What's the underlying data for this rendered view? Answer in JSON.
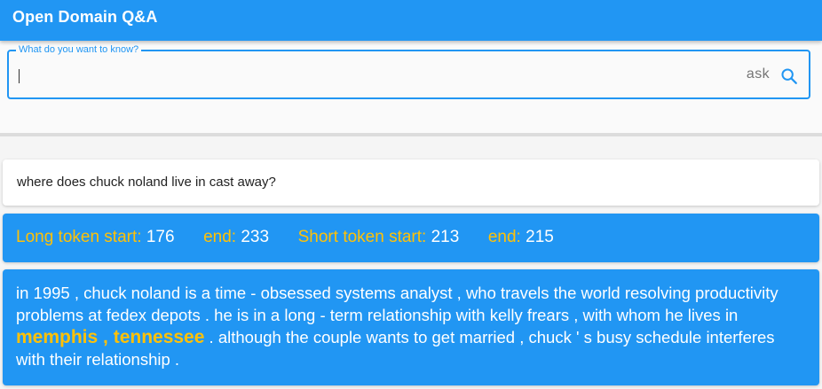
{
  "app": {
    "title": "Open Domain Q&A"
  },
  "search": {
    "label": "What do you want to know?",
    "value": "",
    "ask_label": "ask",
    "icon": "search-icon"
  },
  "question": {
    "text": "where does chuck noland live in cast away?"
  },
  "tokens": {
    "long_start_label": "Long token start:",
    "long_start_value": "176",
    "long_end_label": "end:",
    "long_end_value": "233",
    "short_start_label": "Short token start:",
    "short_start_value": "213",
    "short_end_label": "end:",
    "short_end_value": "215"
  },
  "answer": {
    "before": "in 1995 , chuck noland is a time - obsessed systems analyst , who travels the world resolving productivity problems at fedex depots . he is in a long - term relationship with kelly frears , with whom he lives in ",
    "highlight": "memphis , tennessee",
    "after": " . although the couple wants to get married , chuck ' s busy schedule interferes with their relationship ."
  },
  "colors": {
    "primary": "#2196f3",
    "accent": "#ffc107"
  }
}
